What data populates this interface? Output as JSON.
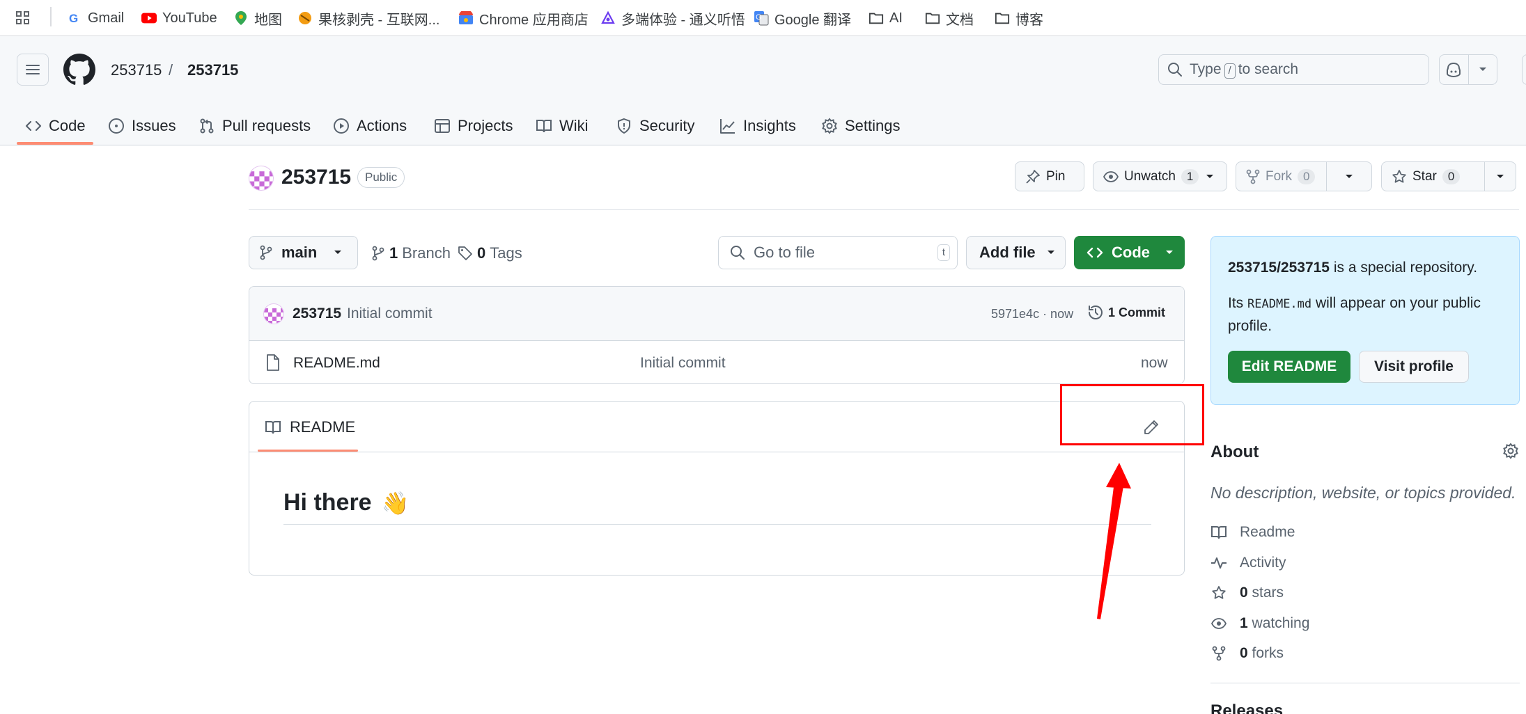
{
  "bookmarks": {
    "items": [
      {
        "label": "Gmail"
      },
      {
        "label": "YouTube"
      },
      {
        "label": "地图"
      },
      {
        "label": "果核剥壳 - 互联网..."
      },
      {
        "label": "Chrome 应用商店"
      },
      {
        "label": "多端体验 - 通义听悟"
      },
      {
        "label": "Google 翻译"
      },
      {
        "label": "AI"
      },
      {
        "label": "文档"
      },
      {
        "label": "博客"
      }
    ]
  },
  "header": {
    "owner": "253715",
    "separator": "/",
    "repo": "253715",
    "search_prefix": "Type",
    "search_key": "/",
    "search_suffix": "to search"
  },
  "tabs": [
    {
      "label": "Code",
      "icon": "code-icon",
      "active": true
    },
    {
      "label": "Issues",
      "icon": "issue-icon"
    },
    {
      "label": "Pull requests",
      "icon": "pull-request-icon"
    },
    {
      "label": "Actions",
      "icon": "play-icon"
    },
    {
      "label": "Projects",
      "icon": "table-icon"
    },
    {
      "label": "Wiki",
      "icon": "book-icon"
    },
    {
      "label": "Security",
      "icon": "shield-icon"
    },
    {
      "label": "Insights",
      "icon": "graph-icon"
    },
    {
      "label": "Settings",
      "icon": "gear-icon"
    }
  ],
  "repo_title": {
    "name": "253715",
    "visibility": "Public",
    "pin_label": "Pin",
    "watch_label": "Unwatch",
    "watch_count": "1",
    "fork_label": "Fork",
    "fork_count": "0",
    "star_label": "Star",
    "star_count": "0"
  },
  "toolbar": {
    "branch": "main",
    "branches_count": "1",
    "branches_label": "Branch",
    "tags_count": "0",
    "tags_label": "Tags",
    "goto_placeholder": "Go to file",
    "goto_key": "t",
    "add_file": "Add file",
    "code": "Code"
  },
  "latest_commit": {
    "author": "253715",
    "message": "Initial commit",
    "hash_time": "5971e4c · now",
    "commits_label": "1 Commit"
  },
  "files": [
    {
      "name": "README.md",
      "message": "Initial commit",
      "time": "now"
    }
  ],
  "readme": {
    "tab_label": "README",
    "heading": "Hi there",
    "emoji": "👋"
  },
  "special_repo": {
    "repo_path": "253715/253715",
    "text1": " is a special repository.",
    "text2_prefix": "Its ",
    "text2_code": "README.md",
    "text2_suffix": " will appear on your public",
    "text2_line2": "profile.",
    "edit_button": "Edit README",
    "visit_button": "Visit profile"
  },
  "about": {
    "title": "About",
    "description": "No description, website, or topics provided.",
    "items": [
      {
        "icon": "book-icon",
        "bold": "",
        "label": "Readme"
      },
      {
        "icon": "pulse-icon",
        "bold": "",
        "label": "Activity"
      },
      {
        "icon": "star-icon",
        "bold": "0",
        "label": " stars"
      },
      {
        "icon": "eye-icon",
        "bold": "1",
        "label": " watching"
      },
      {
        "icon": "fork-icon",
        "bold": "0",
        "label": " forks"
      }
    ],
    "releases_title": "Releases"
  },
  "colors": {
    "accent_green": "#1f883d",
    "tab_underline": "#fd8c73",
    "annotation_red": "#ff0000",
    "special_bg": "#ddf4ff"
  }
}
